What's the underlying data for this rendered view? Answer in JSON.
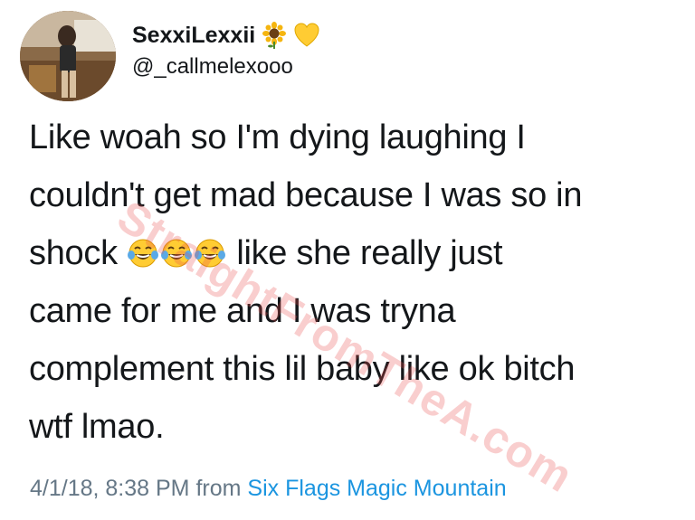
{
  "tweet": {
    "display_name": "SexxiLexxii",
    "name_emojis": [
      "sunflower-icon",
      "yellow-heart-icon"
    ],
    "handle": "@_callmelexooo",
    "body_lines": [
      "Like woah so I'm dying laughing I",
      "couldn't get mad because I was so in",
      "shock",
      "like she really just",
      "came for me and I was tryna",
      "complement this lil baby like ok bitch",
      "wtf lmao."
    ],
    "inline_emojis": [
      "face-with-tears-of-joy-icon",
      "face-with-tears-of-joy-icon",
      "face-with-tears-of-joy-icon"
    ],
    "timestamp": "4/1/18, 8:38 PM",
    "from_label": "from",
    "source": "Six Flags Magic Mountain"
  },
  "watermark": "StraightFromTheA.com",
  "colors": {
    "text": "#14171a",
    "meta": "#657786",
    "link": "#1b95e0",
    "watermark": "#e85050"
  }
}
